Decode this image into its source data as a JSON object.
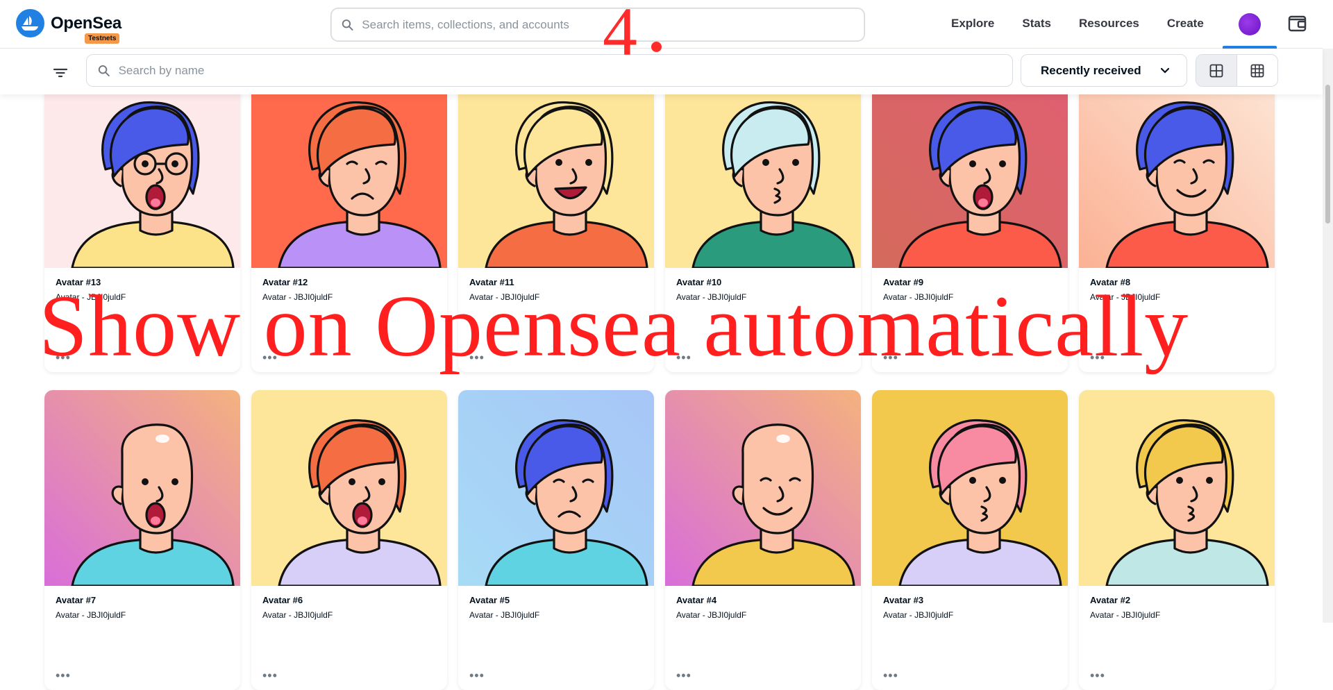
{
  "brand": {
    "name": "OpenSea",
    "badge": "Testnets",
    "color": "#2081e2"
  },
  "header": {
    "search_placeholder": "Search items, collections, and accounts",
    "nav": [
      "Explore",
      "Stats",
      "Resources",
      "Create"
    ],
    "profile_icon": "profile-avatar-icon",
    "wallet_icon": "wallet-icon"
  },
  "toolbar": {
    "filter_icon": "filter-icon",
    "search_placeholder": "Search by name",
    "sort_label": "Recently received",
    "view_modes": [
      "large-grid",
      "small-grid"
    ]
  },
  "annotations": {
    "step": "4",
    "caption": "Show on Opensea automatically",
    "color": "#ff1f1f"
  },
  "items": [
    {
      "name": "Avatar #13",
      "collection": "Avatar - JBJI0juldF",
      "bg": [
        "#fde8ea",
        "#fde8ea"
      ],
      "hair": "#4a5ae8",
      "shirt": "#fce38a",
      "expr": "shout",
      "glasses": true
    },
    {
      "name": "Avatar #12",
      "collection": "Avatar - JBJI0juldF",
      "bg": [
        "#ff6a4d",
        "#ff6a4d"
      ],
      "hair": "#f46d43",
      "shirt": "#b991f7",
      "expr": "sad",
      "glasses": false
    },
    {
      "name": "Avatar #11",
      "collection": "Avatar - JBJI0juldF",
      "bg": [
        "#fde59a",
        "#fde59a"
      ],
      "hair": "#fde59a",
      "shirt": "#f46d43",
      "expr": "laugh",
      "glasses": false
    },
    {
      "name": "Avatar #10",
      "collection": "Avatar - JBJI0juldF",
      "bg": [
        "#fde59a",
        "#fde59a"
      ],
      "hair": "#c8ecf0",
      "shirt": "#2a9b7d",
      "expr": "kiss",
      "glasses": false
    },
    {
      "name": "Avatar #9",
      "collection": "Avatar - JBJI0juldF",
      "bg": [
        "#e05f72",
        "#d46a5c"
      ],
      "hair": "#4a5ae8",
      "shirt": "#fc5b4a",
      "expr": "shout",
      "glasses": false
    },
    {
      "name": "Avatar #8",
      "collection": "Avatar - JBJI0juldF",
      "bg": [
        "#fde6d6",
        "#fbb194"
      ],
      "hair": "#4a5ae8",
      "shirt": "#fc5b4a",
      "expr": "smile",
      "glasses": false
    },
    {
      "name": "Avatar #7",
      "collection": "Avatar - JBJI0juldF",
      "bg": [
        "#f4b27e",
        "#d86ed9"
      ],
      "hair": "bald",
      "shirt": "#5fd3e2",
      "expr": "shout",
      "glasses": false
    },
    {
      "name": "Avatar #6",
      "collection": "Avatar - JBJI0juldF",
      "bg": [
        "#fde59a",
        "#fde59a"
      ],
      "hair": "#f46d43",
      "shirt": "#d7cff7",
      "expr": "shout",
      "glasses": false
    },
    {
      "name": "Avatar #5",
      "collection": "Avatar - JBJI0juldF",
      "bg": [
        "#a7c6f7",
        "#a7dbf5"
      ],
      "hair": "#4a5ae8",
      "shirt": "#5fd3e2",
      "expr": "sad",
      "glasses": false
    },
    {
      "name": "Avatar #4",
      "collection": "Avatar - JBJI0juldF",
      "bg": [
        "#f4b27e",
        "#d86ed9"
      ],
      "hair": "bald",
      "shirt": "#f2c94c",
      "expr": "smile",
      "glasses": false
    },
    {
      "name": "Avatar #3",
      "collection": "Avatar - JBJI0juldF",
      "bg": [
        "#f2c94c",
        "#f2c94c"
      ],
      "hair": "#f88aa1",
      "shirt": "#d7cff7",
      "expr": "kiss",
      "glasses": false
    },
    {
      "name": "Avatar #2",
      "collection": "Avatar - JBJI0juldF",
      "bg": [
        "#fde59a",
        "#fde59a"
      ],
      "hair": "#f2c94c",
      "shirt": "#bfe7e6",
      "expr": "kiss",
      "glasses": false
    }
  ]
}
